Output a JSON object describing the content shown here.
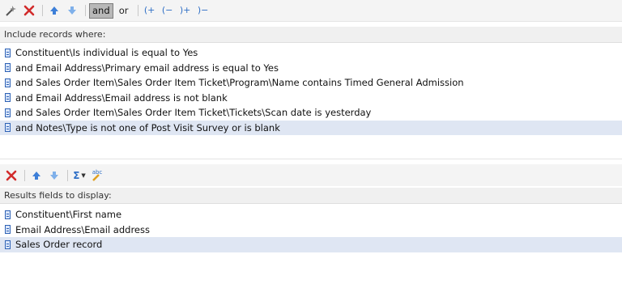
{
  "criteria_toolbar": {
    "and_label": "and",
    "or_label": "or",
    "paren_open_and": "(+",
    "paren_open_minus": "(−",
    "paren_close_and": ")+",
    "paren_close_minus": ")−"
  },
  "criteria": {
    "header": "Include records where:",
    "rows": [
      {
        "text": "Constituent\\Is individual is equal to Yes",
        "selected": false
      },
      {
        "text": "and Email Address\\Primary email address is equal to Yes",
        "selected": false
      },
      {
        "text": "and Sales Order Item\\Sales Order Item Ticket\\Program\\Name contains Timed General Admission",
        "selected": false
      },
      {
        "text": "and Email Address\\Email address is not blank",
        "selected": false
      },
      {
        "text": "and Sales Order Item\\Sales Order Item Ticket\\Tickets\\Scan date is yesterday",
        "selected": false
      },
      {
        "text": "and Notes\\Type is not one of Post Visit Survey or is blank",
        "selected": true
      }
    ]
  },
  "output_toolbar": {
    "sigma_label": "Σ",
    "spell_label": "abc"
  },
  "output": {
    "header": "Results fields to display:",
    "rows": [
      {
        "text": "Constituent\\First name",
        "selected": false
      },
      {
        "text": "Email Address\\Email address",
        "selected": false
      },
      {
        "text": "Sales Order record",
        "selected": true
      }
    ]
  },
  "icons": {
    "filter_tool": "magic-wand-icon",
    "delete": "red-x-icon",
    "move_up": "blue-up-arrow-icon",
    "move_down": "blue-down-arrow-icon",
    "row_document": "document-icon"
  },
  "colors": {
    "accent_blue": "#2f6fc6",
    "delete_red": "#d22b2b",
    "selected_row": "#dfe6f3",
    "and_button_bg": "#b8b8b8"
  }
}
